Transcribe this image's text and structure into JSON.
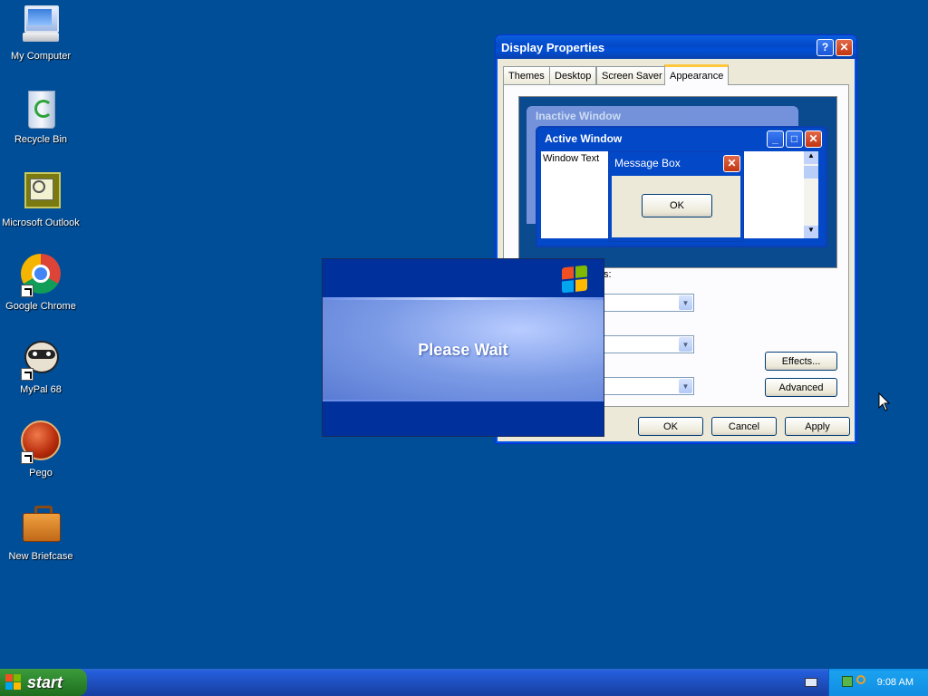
{
  "desktop": {
    "icons": [
      {
        "label": "My Computer",
        "icon": "my-computer-icon"
      },
      {
        "label": "Recycle Bin",
        "icon": "recycle-bin-icon"
      },
      {
        "label": "Microsoft Outlook",
        "icon": "outlook-icon"
      },
      {
        "label": "Google Chrome",
        "icon": "chrome-icon"
      },
      {
        "label": "MyPal 68",
        "icon": "mypal-icon"
      },
      {
        "label": "Pego",
        "icon": "pego-icon"
      },
      {
        "label": "New Briefcase",
        "icon": "briefcase-icon"
      }
    ]
  },
  "display_properties": {
    "title": "Display Properties",
    "tabs": [
      "Themes",
      "Desktop",
      "Screen Saver",
      "Appearance"
    ],
    "active_tab": "Appearance",
    "preview": {
      "inactive_title": "Inactive Window",
      "active_title": "Active Window",
      "window_text": "Window Text",
      "message_box_title": "Message Box",
      "message_box_ok": "OK"
    },
    "partial_label": "s:",
    "effects_button": "Effects...",
    "advanced_button": "Advanced",
    "ok_button": "OK",
    "cancel_button": "Cancel",
    "apply_button": "Apply"
  },
  "please_wait": {
    "text": "Please Wait"
  },
  "taskbar": {
    "start_label": "start",
    "clock": "9:08 AM"
  },
  "colors": {
    "desktop_bg": "#004e98",
    "title_blue": "#0348c7",
    "window_face": "#ece9d8",
    "close_red": "#c23511",
    "start_green": "#2f8a2f"
  }
}
